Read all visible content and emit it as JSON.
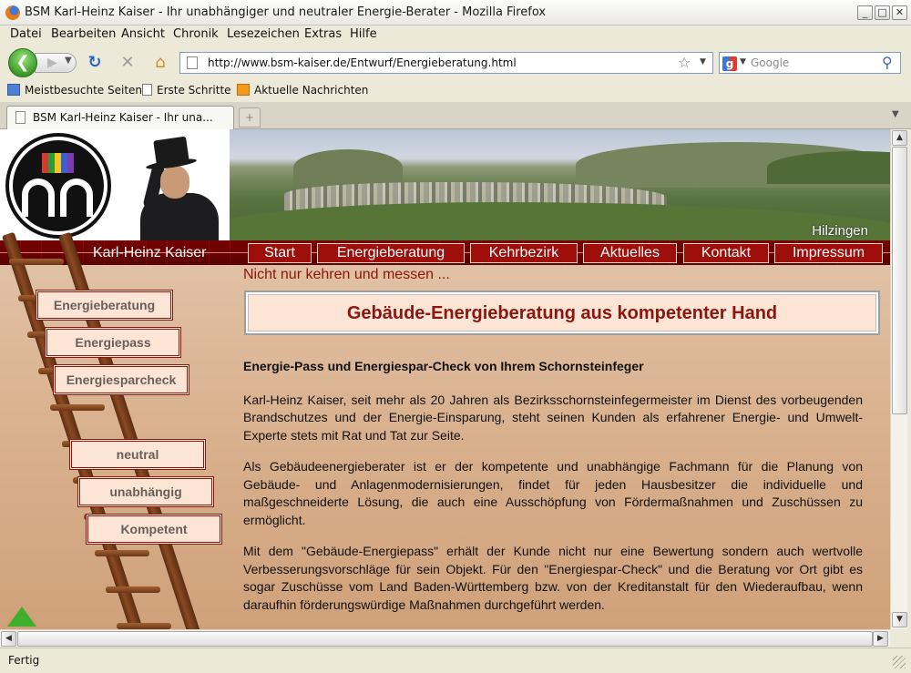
{
  "window": {
    "title": "BSM Karl-Heinz Kaiser - Ihr unabhängiger und neutraler Energie-Berater - Mozilla Firefox"
  },
  "menubar": [
    "Datei",
    "Bearbeiten",
    "Ansicht",
    "Chronik",
    "Lesezeichen",
    "Extras",
    "Hilfe"
  ],
  "navigation": {
    "url": "http://www.bsm-kaiser.de/Entwurf/Energieberatung.html",
    "search_placeholder": "Google"
  },
  "bookmarks": [
    "Meistbesuchte Seiten",
    "Erste Schritte",
    "Aktuelle Nachrichten"
  ],
  "tabs": [
    {
      "label": "BSM Karl-Heinz Kaiser - Ihr una..."
    }
  ],
  "page": {
    "banner_caption": "Hilzingen",
    "owner_name": "Karl-Heinz Kaiser",
    "nav": [
      "Start",
      "Energieberatung",
      "Kehrbezirk",
      "Aktuelles",
      "Kontakt",
      "Impressum"
    ],
    "sidebar_top": [
      "Energieberatung",
      "Energiepass",
      "Energiesparcheck"
    ],
    "sidebar_bottom": [
      "neutral",
      "unabhängig",
      "Kompetent"
    ],
    "tagline": "Nicht nur kehren und messen ...",
    "headline": "Gebäude-Energieberatung aus kompetenter Hand",
    "subheading": "Energie-Pass und Energiespar-Check von Ihrem Schornsteinfeger",
    "paragraphs": [
      "Karl-Heinz Kaiser, seit mehr als 20 Jahren als Bezirksschornsteinfegermeister im Dienst des vorbeugenden Brandschutzes und der Energie-Einsparung, steht seinen Kunden als erfahrener Energie- und Umwelt-Experte stets mit Rat und Tat zur Seite.",
      "Als Gebäudeenergieberater ist er der kompetente und unabhängige Fachmann für die Planung von Gebäude- und Anlagenmodernisierungen, findet für jeden Hausbesitzer die individuelle und maßgeschneiderte Lösung, die auch eine Ausschöpfung von Fördermaßnahmen und Zuschüssen zu ermöglicht.",
      "Mit dem \"Gebäude-Energiepass\" erhält der Kunde nicht nur eine Bewertung sondern auch wertvolle Verbesserungsvorschläge für sein Objekt. Für den \"Energiespar-Check\" und die Beratung vor Ort gibt es sogar Zuschüsse vom Land Baden-Württemberg bzw. von der Kreditanstalt für den Wiederaufbau, wenn daraufhin förderungswürdige Maßnahmen durchgeführt werden."
    ]
  },
  "status": "Fertig",
  "colors": {
    "accent_red": "#9e0f0b",
    "headline_red": "#8b1510",
    "button_fill": "#fde5d6",
    "back_green": "#3a9a26"
  }
}
